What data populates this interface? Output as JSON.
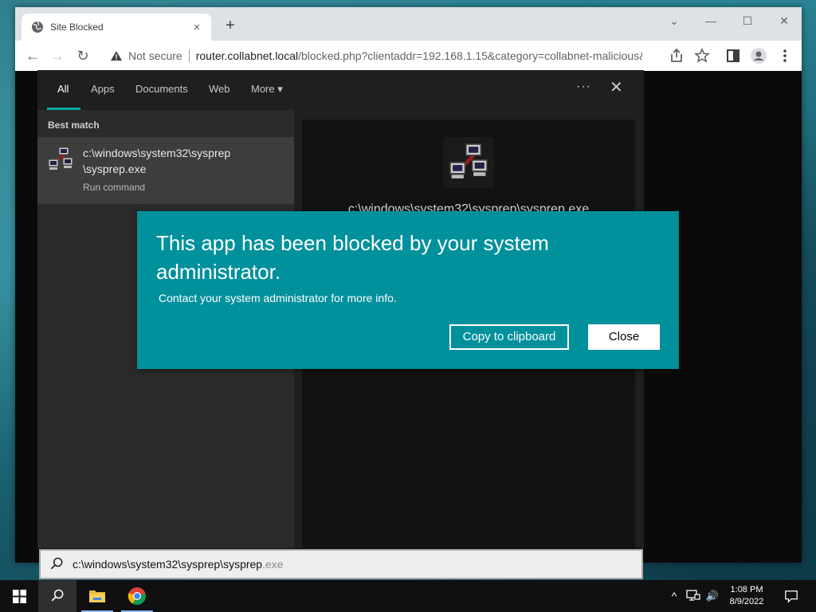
{
  "browser": {
    "tab_title": "Site Blocked",
    "tab_close": "×",
    "new_tab": "+",
    "window_controls": {
      "chevron": "⌄",
      "minimize": "—",
      "maximize": "☐",
      "close": "✕"
    },
    "toolbar": {
      "back": "←",
      "forward": "→",
      "reload": "↻",
      "security_label": "Not secure",
      "url_domain": "router.collabnet.local",
      "url_path": "/blocked.php?clientaddr=192.168.1.15&category=collabnet-malicious&..."
    }
  },
  "search": {
    "tabs": [
      "All",
      "Apps",
      "Documents",
      "Web",
      "More"
    ],
    "more_caret": "▾",
    "ellipsis": "···",
    "close": "✕",
    "best_match_label": "Best match",
    "result": {
      "title": "c:\\windows\\system32\\sysprep\\sysprep.exe",
      "title_line1": "c:\\windows\\system32\\sysprep",
      "title_line2": "\\sysprep.exe",
      "subtitle": "Run command"
    },
    "preview_title": "c:\\windows\\system32\\sysprep\\sysprep.exe",
    "query_typed": "c:\\windows\\system32\\sysprep\\sysprep",
    "query_completion": ".exe"
  },
  "dialog": {
    "title": "This app has been blocked by your system administrator.",
    "message": "Contact your system administrator for more info.",
    "copy_button": "Copy to clipboard",
    "close_button": "Close",
    "background_color": "#01919c"
  },
  "taskbar": {
    "apps": [
      "start-icon",
      "search-icon",
      "file-explorer-icon",
      "chrome-icon"
    ],
    "tray": {
      "chevron": "^",
      "volume": "🔊"
    },
    "time": "1:08 PM",
    "date": "8/9/2022"
  }
}
